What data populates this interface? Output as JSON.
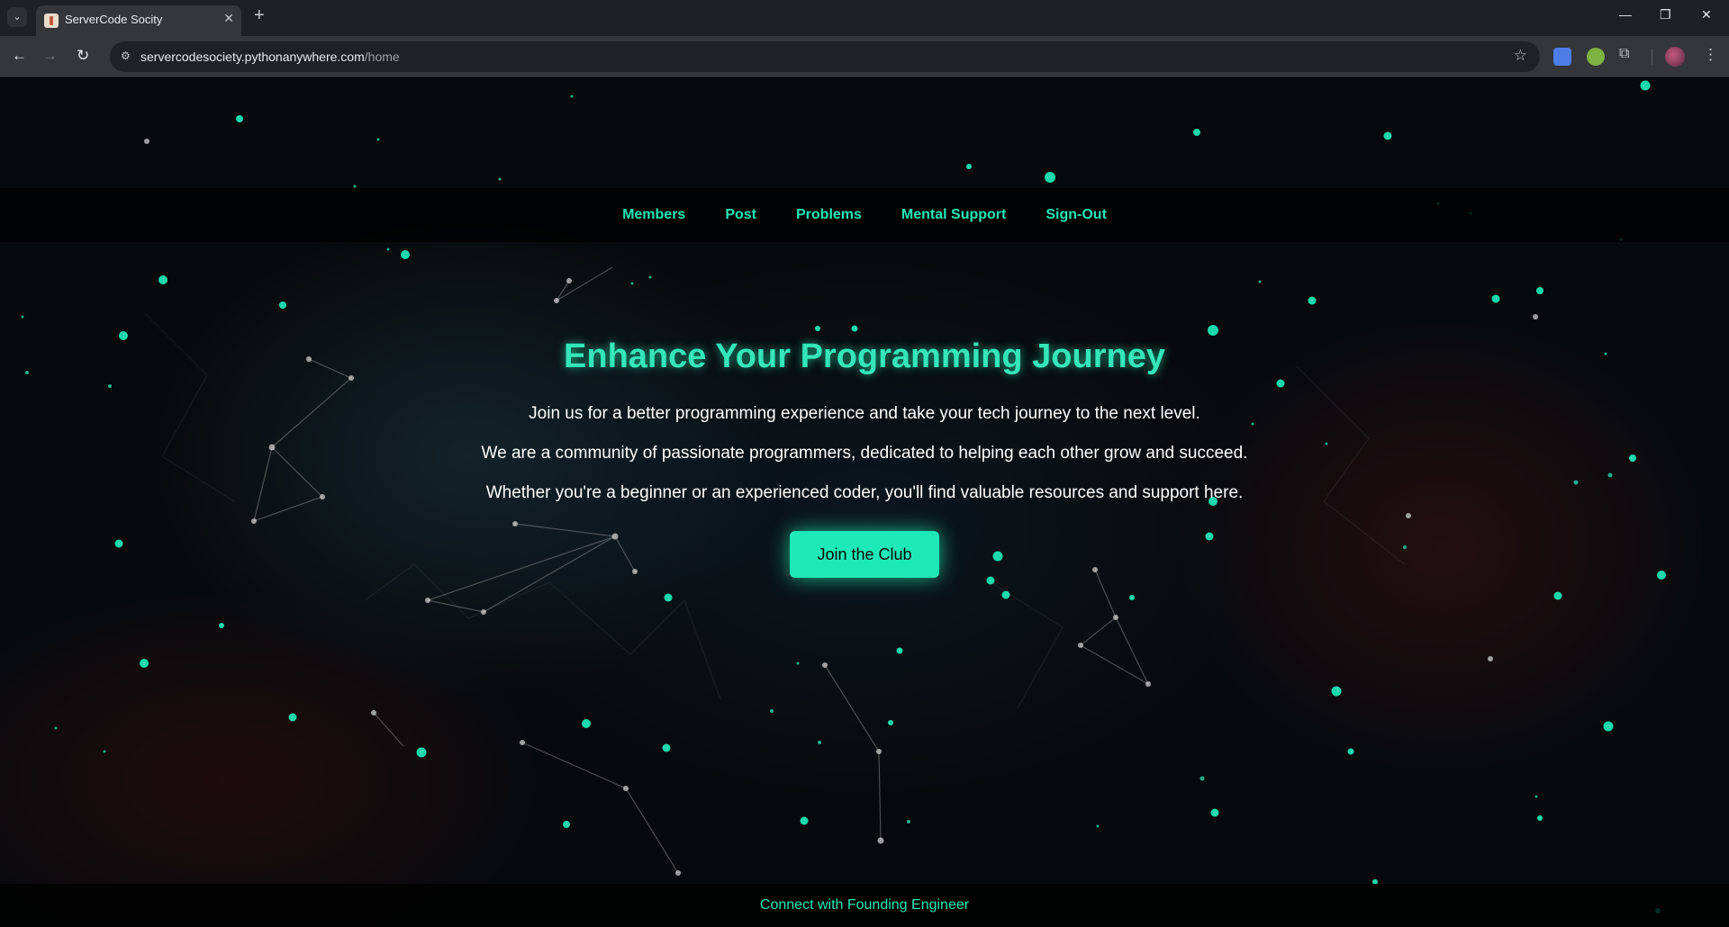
{
  "browser": {
    "tab_title": "ServerCode Socity",
    "url_host": "servercodesociety.pythonanywhere.com",
    "url_path": "/home",
    "new_tab_glyph": "+",
    "tab_close_glyph": "✕",
    "window_controls": {
      "minimize": "—",
      "restore": "❐",
      "close": "✕"
    },
    "icons": [
      "tab-search-icon",
      "back-icon",
      "forward-icon",
      "reload-icon",
      "site-info-icon",
      "bookmark-star-icon",
      "translate-extension-icon",
      "green-extension-icon",
      "extensions-puzzle-icon",
      "profile-avatar",
      "menu-kebab-icon"
    ]
  },
  "nav": {
    "links": [
      "Members",
      "Post",
      "Problems",
      "Mental Support",
      "Sign-Out"
    ]
  },
  "hero": {
    "title": "Enhance Your Programming Journey",
    "lines": [
      "Join us for a better programming experience and take your tech journey to the next level.",
      "We are a community of passionate programmers, dedicated to helping each other grow and succeed.",
      "Whether you're a beginner or an experienced coder, you'll find valuable resources and support here."
    ],
    "cta": "Join the Club"
  },
  "footer": {
    "link": "Connect with Founding Engineer"
  },
  "colors": {
    "accent": "#1de9b6",
    "page_bg": "#070a0d",
    "chrome_bg": "#35363a"
  }
}
